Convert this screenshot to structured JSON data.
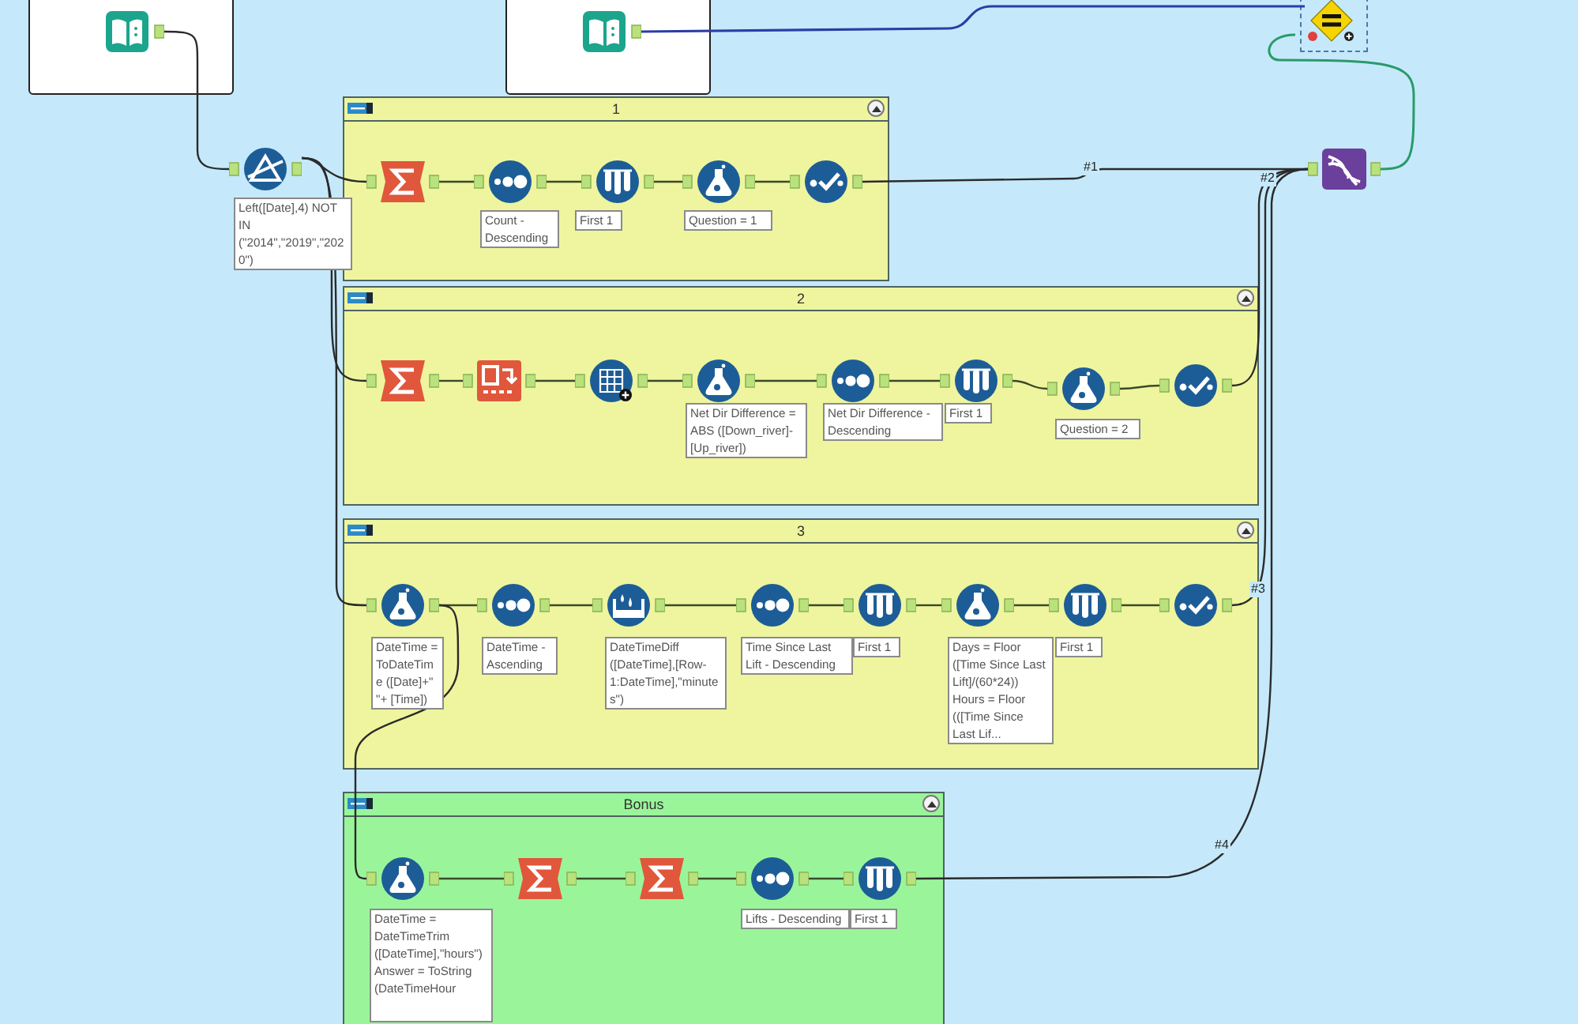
{
  "free_tools": [
    {
      "kind": "input"
    },
    {
      "kind": "input"
    },
    {
      "kind": "filter",
      "annotation": "Left([Date],4) NOT IN (\"2014\",\"2019\",\"2020\")"
    },
    {
      "kind": "test"
    },
    {
      "kind": "union"
    }
  ],
  "containers": [
    {
      "title": "1",
      "color": "#eef59e",
      "tools": [
        {
          "kind": "summarize"
        },
        {
          "kind": "sort",
          "annotation": "Count - Descending"
        },
        {
          "kind": "sample",
          "annotation": "First 1"
        },
        {
          "kind": "formula",
          "annotation": "Question = 1"
        },
        {
          "kind": "select"
        }
      ]
    },
    {
      "title": "2",
      "color": "#eef59e",
      "tools": [
        {
          "kind": "summarize"
        },
        {
          "kind": "transpose"
        },
        {
          "kind": "multifield"
        },
        {
          "kind": "formula",
          "annotation": "Net Dir Difference = ABS ([Down_river]-[Up_river])"
        },
        {
          "kind": "sort",
          "annotation": "Net Dir Difference - Descending"
        },
        {
          "kind": "sample",
          "annotation": "First 1"
        },
        {
          "kind": "formula",
          "annotation": "Question = 2"
        },
        {
          "kind": "select"
        }
      ]
    },
    {
      "title": "3",
      "color": "#eef59e",
      "tools": [
        {
          "kind": "formula",
          "annotation": "DateTime = ToDateTime ([Date]+\" \"+ [Time])"
        },
        {
          "kind": "sort",
          "annotation": "DateTime - Ascending"
        },
        {
          "kind": "multirow",
          "annotation": "DateTimeDiff ([DateTime],[Row-1:DateTime],\"minutes\")"
        },
        {
          "kind": "sort",
          "annotation": "Time Since Last Lift - Descending"
        },
        {
          "kind": "sample",
          "annotation": "First 1"
        },
        {
          "kind": "formula",
          "annotation": "Days = Floor ([Time Since Last Lift]/(60*24)) Hours = Floor (([Time Since Last Lif..."
        },
        {
          "kind": "sample",
          "annotation": "First 1"
        },
        {
          "kind": "select"
        }
      ]
    },
    {
      "title": "Bonus",
      "color": "#9af59a",
      "tools": [
        {
          "kind": "formula",
          "annotation": "DateTime = DateTimeTrim ([DateTime],\"hours\") Answer = ToString (DateTimeHour"
        },
        {
          "kind": "summarize"
        },
        {
          "kind": "summarize"
        },
        {
          "kind": "sort",
          "annotation": "Lifts - Descending"
        },
        {
          "kind": "sample",
          "annotation": "First 1"
        }
      ]
    }
  ],
  "connector_labels": [
    "#1",
    "#2",
    "#3",
    "#4"
  ]
}
